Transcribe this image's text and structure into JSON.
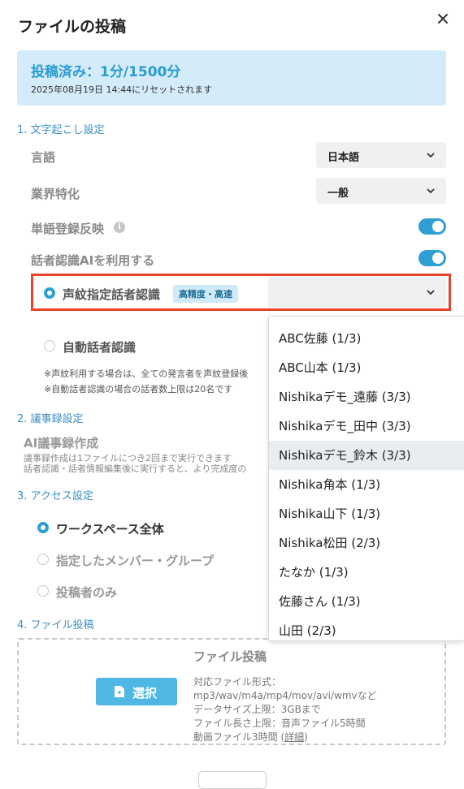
{
  "dialog": {
    "title": "ファイルの投稿"
  },
  "quota": {
    "main": "投稿済み：1分/1500分",
    "reset": "2025年08月19日 14:44にリセットされます"
  },
  "section1": {
    "heading": "1. 文字起こし設定",
    "language": {
      "label": "言語",
      "value": "日本語"
    },
    "industry": {
      "label": "業界特化",
      "value": "一般"
    },
    "word_registration": {
      "label": "単語登録反映",
      "enabled": true
    },
    "speaker_ai": {
      "label": "話者認識AIを利用する",
      "enabled": true
    },
    "voiceprint": {
      "label": "声紋指定話者認識",
      "badge": "高精度・高速",
      "selected": true
    },
    "auto_speaker": {
      "label": "自動話者認識",
      "selected": false
    },
    "notes": [
      "※声紋利用する場合は、全ての発言者を声紋登録後",
      "※自動話者認識の場合の話者数上限は20名です"
    ]
  },
  "section2": {
    "heading": "2. 議事録設定",
    "ai_minutes": {
      "title": "AI議事録作成",
      "notes": [
        "議事録作成は1ファイルにつき2回まで実行できます",
        "話者認識・話者情報編集後に実行すると、より完成度の"
      ]
    }
  },
  "section3": {
    "heading": "3. アクセス設定",
    "options": [
      {
        "label": "ワークスペース全体",
        "selected": true
      },
      {
        "label": "指定したメンバー・グループ",
        "selected": false
      },
      {
        "label": "投稿者のみ",
        "selected": false
      }
    ]
  },
  "section4": {
    "heading": "4. ファイル投稿",
    "upload": {
      "title": "ファイル投稿",
      "button": "選択",
      "formats": [
        "対応ファイル形式：",
        "mp3/wav/m4a/mp4/mov/avi/wmvなど",
        "データサイズ上限：3GBまで",
        "ファイル長さ上限：音声ファイル5時間"
      ],
      "video_limit": "動画ファイル3時間 (",
      "details_link": "詳細",
      "video_limit_close": ")"
    }
  },
  "voiceprint_dropdown": {
    "highlighted_index": 4,
    "options": [
      "ABC佐藤 (1/3)",
      "ABC山本 (1/3)",
      "Nishikaデモ_遠藤 (3/3)",
      "Nishikaデモ_田中 (3/3)",
      "Nishikaデモ_鈴木 (3/3)",
      "Nishika角本 (1/3)",
      "Nishika山下 (1/3)",
      "Nishika松田 (2/3)",
      "たなか (1/3)",
      "佐藤さん (1/3)",
      "山田 (2/3)"
    ]
  },
  "colors": {
    "accent": "#2e9fd2",
    "highlight_border": "#e8412b",
    "quota_bg": "#d4ecf9"
  }
}
